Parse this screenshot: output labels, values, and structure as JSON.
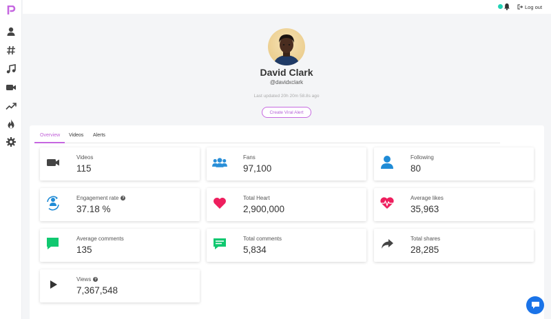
{
  "app": {
    "logo_letter": "P",
    "accent_color": "#c566e0"
  },
  "sidebar": {
    "items": [
      {
        "icon": "user-icon"
      },
      {
        "icon": "hashtag-icon"
      },
      {
        "icon": "music-icon"
      },
      {
        "icon": "video-icon"
      },
      {
        "icon": "trending-icon"
      },
      {
        "icon": "fire-icon"
      },
      {
        "icon": "gear-icon"
      }
    ]
  },
  "topbar": {
    "logout_label": "Log out",
    "status_color": "#21d3b6"
  },
  "profile": {
    "name": "David Clark",
    "handle": "@davidxclark",
    "last_updated": "Last updated 20h 20m 58.8s ago",
    "alert_button": "Create Viral Alert"
  },
  "tabs": [
    {
      "label": "Overview",
      "active": true
    },
    {
      "label": "Videos",
      "active": false
    },
    {
      "label": "Alerts",
      "active": false
    }
  ],
  "stats": [
    {
      "label": "Videos",
      "value": "115",
      "icon": "video-camera-icon",
      "color": "#444444"
    },
    {
      "label": "Fans",
      "value": "97,100",
      "icon": "users-icon",
      "color": "#2a8fd8"
    },
    {
      "label": "Following",
      "value": "80",
      "icon": "user-icon",
      "color": "#1f8bd6"
    },
    {
      "label": "Engagement rate",
      "value": "37.18 %",
      "icon": "engagement-icon",
      "color": "#1f8bd6",
      "help": "?"
    },
    {
      "label": "Total Heart",
      "value": "2,900,000",
      "icon": "heart-icon",
      "color": "#ee1f5e"
    },
    {
      "label": "Average likes",
      "value": "35,963",
      "icon": "heartbeat-icon",
      "color": "#ee1f5e"
    },
    {
      "label": "Average comments",
      "value": "135",
      "icon": "comment-icon",
      "color": "#10c870"
    },
    {
      "label": "Total comments",
      "value": "5,834",
      "icon": "comments-icon",
      "color": "#10c870"
    },
    {
      "label": "Total shares",
      "value": "28,285",
      "icon": "share-icon",
      "color": "#444444"
    },
    {
      "label": "Views",
      "value": "7,367,548",
      "icon": "play-icon",
      "color": "#333333",
      "help": "?"
    }
  ]
}
